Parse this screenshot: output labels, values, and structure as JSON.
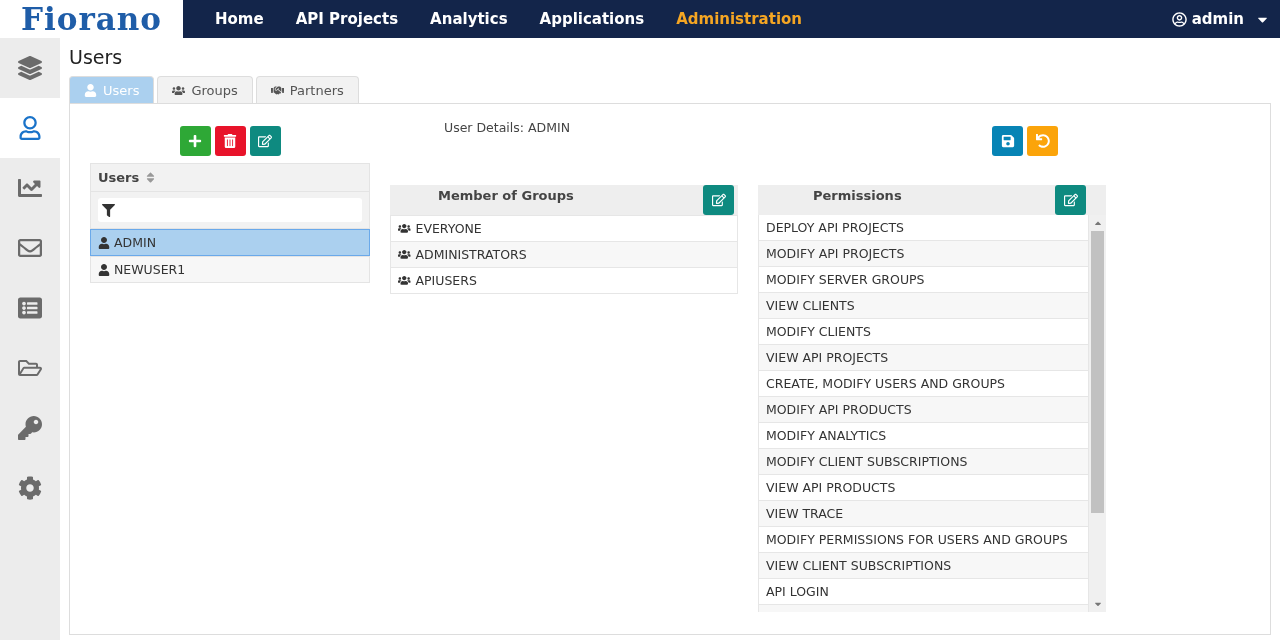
{
  "logo": "Fiorano",
  "nav": [
    {
      "label": "Home",
      "selected": false
    },
    {
      "label": "API Projects",
      "selected": false
    },
    {
      "label": "Analytics",
      "selected": false
    },
    {
      "label": "Applications",
      "selected": false
    },
    {
      "label": "Administration",
      "selected": true
    }
  ],
  "user_menu": {
    "label": "admin"
  },
  "sidebar": {
    "items": [
      {
        "kind": "layers",
        "selected": false
      },
      {
        "kind": "user",
        "selected": true
      },
      {
        "kind": "chart",
        "selected": false
      },
      {
        "kind": "mail",
        "selected": false
      },
      {
        "kind": "list",
        "selected": false
      },
      {
        "kind": "folder",
        "selected": false
      },
      {
        "kind": "key",
        "selected": false
      },
      {
        "kind": "settings",
        "selected": false
      }
    ]
  },
  "page_title": "Users",
  "tabs": [
    {
      "label": "Users",
      "kind": "user",
      "selected": true
    },
    {
      "label": "Groups",
      "kind": "groups",
      "selected": false
    },
    {
      "label": "Partners",
      "kind": "handshake",
      "selected": false
    }
  ],
  "users_table": {
    "column": "Users",
    "rows": [
      {
        "name": "ADMIN",
        "selected": true
      },
      {
        "name": "NEWUSER1",
        "selected": false
      }
    ]
  },
  "user_details": "User Details: ADMIN",
  "groups": {
    "title": "Member of Groups",
    "rows": [
      "EVERYONE",
      "ADMINISTRATORS",
      "APIUSERS"
    ]
  },
  "permissions": {
    "title": "Permissions",
    "rows": [
      "DEPLOY API PROJECTS",
      "MODIFY API PROJECTS",
      "MODIFY SERVER GROUPS",
      "VIEW CLIENTS",
      "MODIFY CLIENTS",
      "VIEW API PROJECTS",
      "CREATE, MODIFY USERS AND GROUPS",
      "MODIFY API PRODUCTS",
      "MODIFY ANALYTICS",
      "MODIFY CLIENT SUBSCRIPTIONS",
      "VIEW API PRODUCTS",
      "VIEW TRACE",
      "MODIFY PERMISSIONS FOR USERS AND GROUPS",
      "VIEW CLIENT SUBSCRIPTIONS",
      "API LOGIN"
    ]
  }
}
